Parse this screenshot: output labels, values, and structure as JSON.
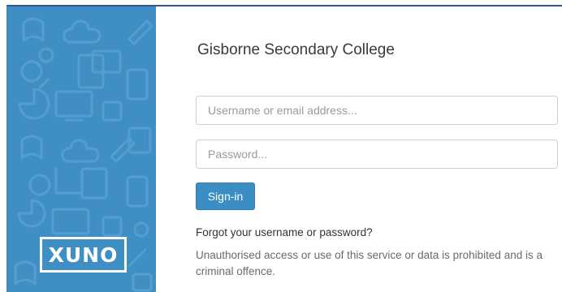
{
  "brand": {
    "logo_text": "XUNO",
    "sidebar_color": "#3f8fc5"
  },
  "login": {
    "school_name": "Gisborne Secondary College",
    "username_placeholder": "Username or email address...",
    "password_placeholder": "Password...",
    "signin_label": "Sign-in",
    "forgot_link": "Forgot your username or password?",
    "warning_text": "Unauthorised access or use of this service or data is prohibited and is a criminal offence.",
    "button_color": "#3a8ec4"
  }
}
